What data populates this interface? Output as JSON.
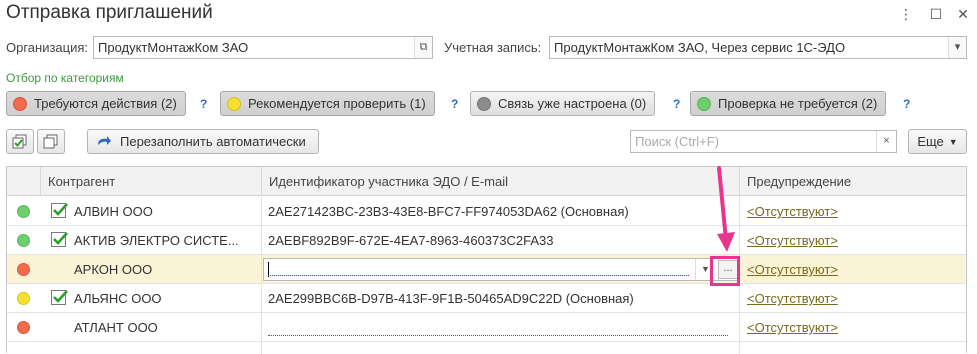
{
  "window": {
    "title": "Отправка приглашений",
    "menu_icon": "more-vert-icon",
    "maximize_icon": "maximize-icon",
    "close_icon": "close-icon"
  },
  "form": {
    "org_label": "Организация:",
    "org_value": "ПродуктМонтажКом ЗАО",
    "account_label": "Учетная запись:",
    "account_value": "ПродуктМонтажКом ЗАО, Через сервис 1С-ЭДО"
  },
  "filter": {
    "title": "Отбор по категориям",
    "categories": [
      {
        "label": "Требуются действия (2)",
        "color": "#f26b4c",
        "pressed": true
      },
      {
        "label": "Рекомендуется проверить (1)",
        "color": "#f5e12f",
        "pressed": true
      },
      {
        "label": "Связь уже настроена (0)",
        "color": "#8c8c8c",
        "pressed": false
      },
      {
        "label": "Проверка не требуется (2)",
        "color": "#6cd06c",
        "pressed": true
      }
    ],
    "help": "?"
  },
  "toolbar": {
    "check_all_icon": "check-all-icon",
    "uncheck_all_icon": "uncheck-all-icon",
    "refill_label": "Перезаполнить автоматически",
    "search_placeholder": "Поиск (Ctrl+F)",
    "clear_label": "×",
    "more_label": "Еще"
  },
  "table": {
    "columns": [
      "Контрагент",
      "Идентификатор участника ЭДО / E-mail",
      "Предупреждение"
    ],
    "rows": [
      {
        "status_color": "#6cd06c",
        "checked": true,
        "name": "АЛВИН ООО",
        "id": "2AE271423BC-23B3-43E8-BFC7-FF974053DA62 (Основная)",
        "warning": "<Отсутствуют>"
      },
      {
        "status_color": "#6cd06c",
        "checked": true,
        "name": "АКТИВ ЭЛЕКТРО СИСТЕ...",
        "id": "2AEBF892B9F-672E-4EA7-8963-460373C2FA33",
        "warning": "<Отсутствуют>"
      },
      {
        "status_color": "#f26b4c",
        "checked": false,
        "name": "АРКОН ООО",
        "id": "",
        "warning": "<Отсутствуют>"
      },
      {
        "status_color": "#f5e12f",
        "checked": true,
        "name": "АЛЬЯНС ООО",
        "id": "2AE299BBC6B-D97B-413F-9F1B-50465AD9C22D (Основная)",
        "warning": "<Отсутствуют>"
      },
      {
        "status_color": "#f26b4c",
        "checked": false,
        "name": "АТЛАНТ ООО",
        "id": "",
        "warning": "<Отсутствуют>"
      }
    ],
    "select_button": "...",
    "dropdown_icon": "chevron-down-icon"
  },
  "annotation": {
    "color": "#e8358f"
  }
}
